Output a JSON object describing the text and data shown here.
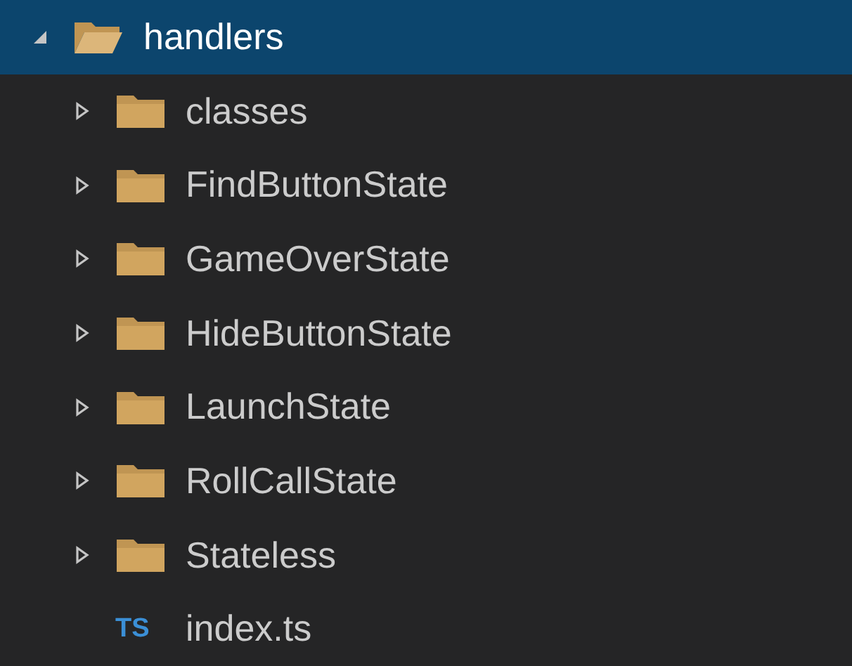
{
  "tree": [
    {
      "name": "handlers",
      "kind": "folder",
      "expanded": true,
      "selected": true,
      "children": [
        {
          "name": "classes",
          "kind": "folder",
          "expanded": false,
          "selected": false
        },
        {
          "name": "FindButtonState",
          "kind": "folder",
          "expanded": false,
          "selected": false
        },
        {
          "name": "GameOverState",
          "kind": "folder",
          "expanded": false,
          "selected": false
        },
        {
          "name": "HideButtonState",
          "kind": "folder",
          "expanded": false,
          "selected": false
        },
        {
          "name": "LaunchState",
          "kind": "folder",
          "expanded": false,
          "selected": false
        },
        {
          "name": "RollCallState",
          "kind": "folder",
          "expanded": false,
          "selected": false
        },
        {
          "name": "Stateless",
          "kind": "folder",
          "expanded": false,
          "selected": false
        },
        {
          "name": "index.ts",
          "kind": "file",
          "badge": "TS",
          "selected": false
        }
      ]
    }
  ]
}
